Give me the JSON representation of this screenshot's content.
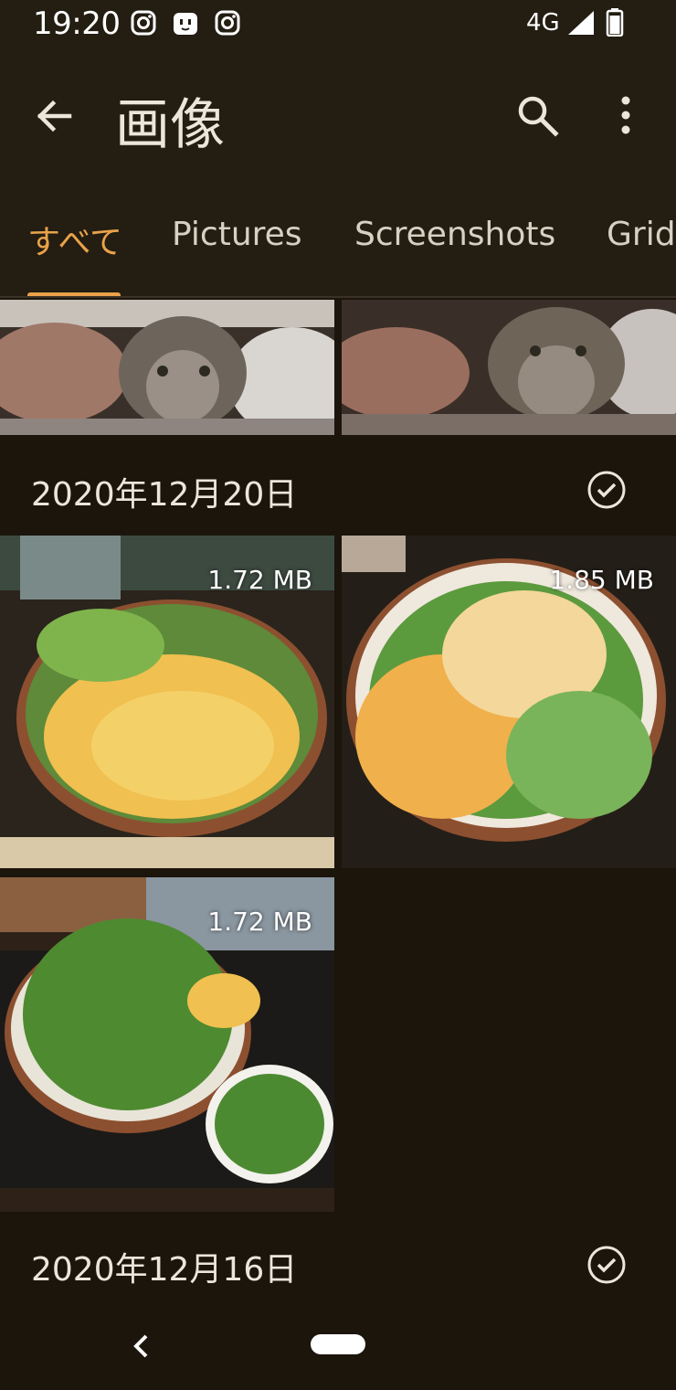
{
  "status_bar": {
    "time": "19:20",
    "network": "4G",
    "icons": [
      "instagram-icon",
      "app-face-icon",
      "instagram-icon",
      "signal-icon",
      "battery-icon"
    ]
  },
  "app_bar": {
    "title": "画像",
    "back_icon": "arrow-back-icon",
    "search_icon": "search-icon",
    "more_icon": "more-vert-icon"
  },
  "tabs": [
    {
      "label": "すべて",
      "active": true
    },
    {
      "label": "Pictures",
      "active": false
    },
    {
      "label": "Screenshots",
      "active": false
    },
    {
      "label": "Grid",
      "active": false
    }
  ],
  "colors": {
    "accent": "#e9a24a",
    "background": "#1b150c",
    "surface": "#231d12"
  },
  "sections": [
    {
      "date": "2020年12月20日",
      "photos": [
        {
          "subject": "udon-tenkasu-bowl",
          "size": "1.72 MB"
        },
        {
          "subject": "udon-tenkasu-green-onion-bowl",
          "size": "1.85 MB"
        },
        {
          "subject": "udon-green-onion-bowl",
          "size": "1.72 MB"
        }
      ]
    },
    {
      "date": "2020年12月16日",
      "photos": []
    }
  ],
  "nav_bar": {
    "back_icon": "nav-back-icon",
    "home_icon": "home-pill-icon"
  }
}
